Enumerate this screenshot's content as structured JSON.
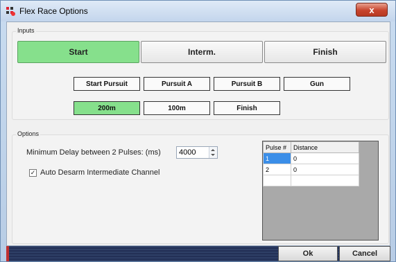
{
  "window": {
    "title": "Flex Race Options",
    "close_label": "x"
  },
  "inputs": {
    "group_label": "Inputs",
    "main_buttons": [
      {
        "label": "Start",
        "active": true
      },
      {
        "label": "Interm.",
        "active": false
      },
      {
        "label": "Finish",
        "active": false
      }
    ],
    "channel_buttons": [
      {
        "label": "Start Pursuit",
        "active": false
      },
      {
        "label": "Pursuit A",
        "active": false
      },
      {
        "label": "Pursuit B",
        "active": false
      },
      {
        "label": "Gun",
        "active": false
      }
    ],
    "distance_buttons": [
      {
        "label": "200m",
        "active": true
      },
      {
        "label": "100m",
        "active": false
      },
      {
        "label": "Finish",
        "active": false
      }
    ]
  },
  "options": {
    "group_label": "Options",
    "min_delay_label": "Minimum Delay between 2 Pulses: (ms)",
    "min_delay_value": "4000",
    "auto_desarm_label": "Auto Desarm Intermediate Channel",
    "auto_desarm_checked": true
  },
  "pulse_table": {
    "columns": [
      "Pulse #",
      "Distance"
    ],
    "rows": [
      [
        "1",
        "0"
      ],
      [
        "2",
        "0"
      ],
      [
        "",
        ""
      ]
    ]
  },
  "footer": {
    "ok_label": "Ok",
    "cancel_label": "Cancel"
  },
  "colors": {
    "active_green": "#86e08c",
    "selection_blue": "#3b8ee8",
    "close_red": "#c7452e"
  }
}
